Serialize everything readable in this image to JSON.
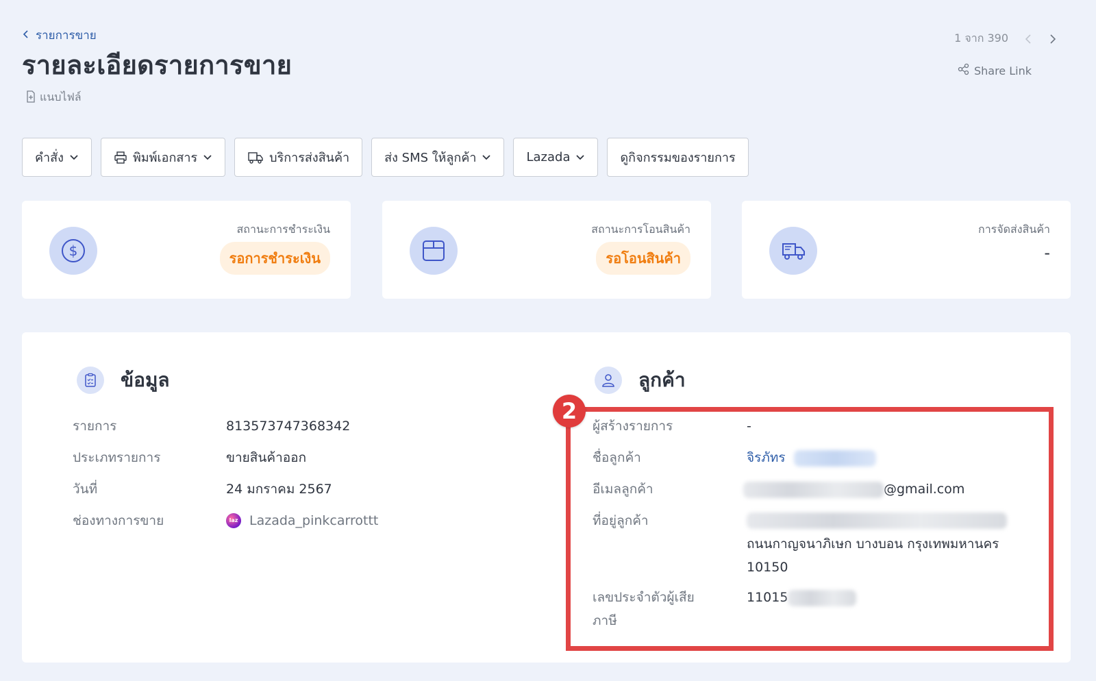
{
  "breadcrumb": {
    "label": "รายการขาย"
  },
  "page_title": "รายละเอียดรายการขาย",
  "attachment": {
    "label": "แนบไฟล์"
  },
  "pager": {
    "text": "1 จาก 390"
  },
  "share": {
    "label": "Share Link"
  },
  "toolbar": {
    "command": "คำสั่ง",
    "print": "พิมพ์เอกสาร",
    "shipping_service": "บริการส่งสินค้า",
    "sms": "ส่ง SMS ให้ลูกค้า",
    "lazada": "Lazada",
    "activity": "ดูกิจกรรมของรายการ"
  },
  "status_cards": {
    "payment": {
      "label": "สถานะการชำระเงิน",
      "value": "รอการชำระเงิน"
    },
    "transfer": {
      "label": "สถานะการโอนสินค้า",
      "value": "รอโอนสินค้า"
    },
    "delivery": {
      "label": "การจัดส่งสินค้า",
      "value": "-"
    }
  },
  "info": {
    "title": "ข้อมูล",
    "order_label": "รายการ",
    "order_value": "813573747368342",
    "type_label": "ประเภทรายการ",
    "type_value": "ขายสินค้าออก",
    "date_label": "วันที่",
    "date_value": "24 มกราคม 2567",
    "channel_label": "ช่องทางการขาย",
    "channel_value": "Lazada_pinkcarrottt",
    "channel_logo_text": "laz"
  },
  "customer": {
    "title": "ลูกค้า",
    "creator_label": "ผู้สร้างรายการ",
    "creator_value": "-",
    "name_label": "ชื่อลูกค้า",
    "name_value": "จิรภัทร",
    "email_label": "อีเมลลูกค้า",
    "email_value": "@gmail.com",
    "address_label": "ที่อยู่ลูกค้า",
    "address_line2": "ถนนกาญจนาภิเษก บางบอน กรุงเทพมหานคร",
    "address_line3": "10150",
    "tax_label_1": "เลขประจำตัวผู้เสีย",
    "tax_label_2": "ภาษี",
    "tax_value": "11015"
  },
  "annotation": {
    "badge": "2"
  },
  "colors": {
    "accent_blue": "#2e5da8",
    "pending_orange": "#f07d10",
    "pending_bg": "#fff1e0",
    "icon_circle": "#cfdaf6",
    "highlight_red": "#e14545"
  }
}
